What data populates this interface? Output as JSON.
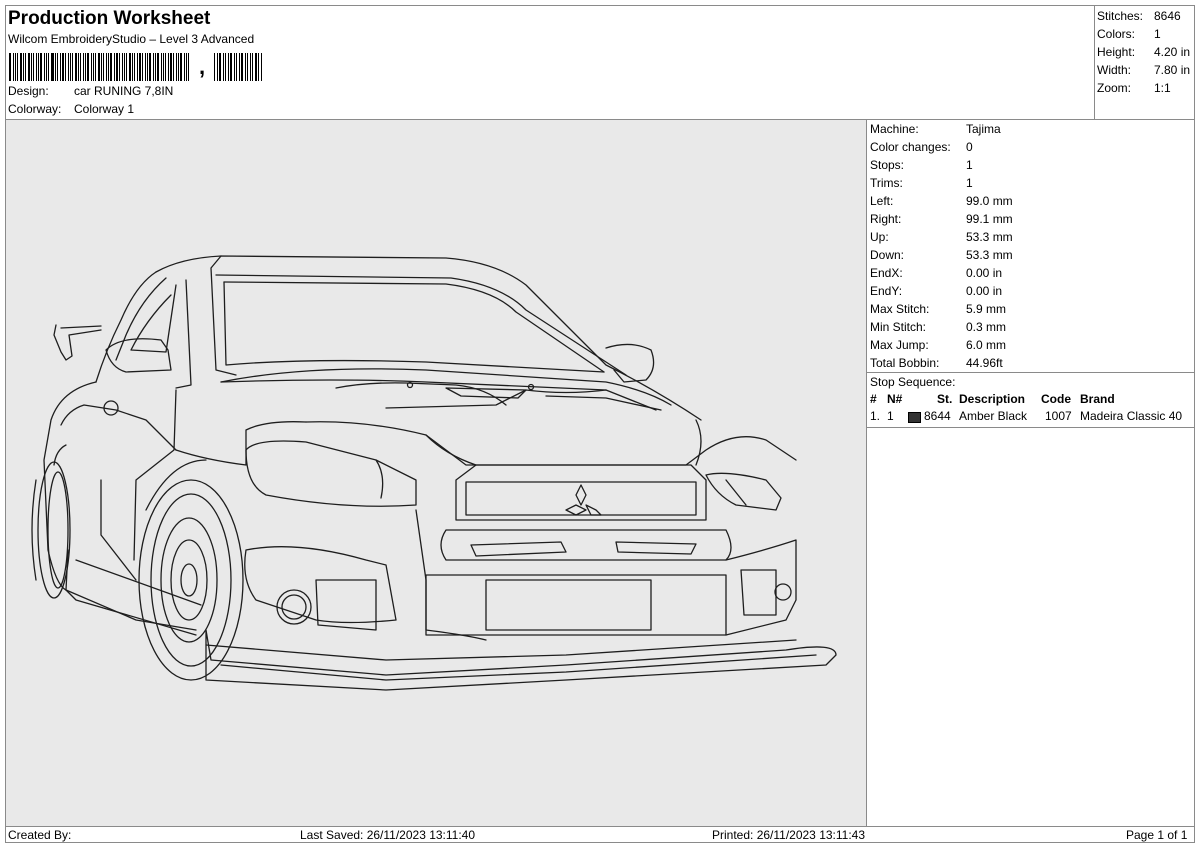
{
  "header": {
    "title": "Production Worksheet",
    "subtitle": "Wilcom EmbroideryStudio – Level 3 Advanced",
    "barcode_suffix": ",",
    "design_label": "Design:",
    "design_value": "car RUNING 7,8IN",
    "colorway_label": "Colorway:",
    "colorway_value": "Colorway 1"
  },
  "stats": [
    {
      "label": "Stitches:",
      "value": "8646"
    },
    {
      "label": "Colors:",
      "value": "1"
    },
    {
      "label": "Height:",
      "value": "4.20 in"
    },
    {
      "label": "Width:",
      "value": "7.80 in"
    },
    {
      "label": "Zoom:",
      "value": "1:1"
    }
  ],
  "details": [
    {
      "label": "Machine:",
      "value": "Tajima"
    },
    {
      "label": "Color changes:",
      "value": "0"
    },
    {
      "label": "Stops:",
      "value": "1"
    },
    {
      "label": "Trims:",
      "value": "1"
    },
    {
      "label": "Left:",
      "value": "99.0 mm"
    },
    {
      "label": "Right:",
      "value": "99.1 mm"
    },
    {
      "label": "Up:",
      "value": "53.3 mm"
    },
    {
      "label": "Down:",
      "value": "53.3 mm"
    },
    {
      "label": "EndX:",
      "value": "0.00 in"
    },
    {
      "label": "EndY:",
      "value": "0.00 in"
    },
    {
      "label": "Max Stitch:",
      "value": "5.9 mm"
    },
    {
      "label": "Min Stitch:",
      "value": "0.3 mm"
    },
    {
      "label": "Max Jump:",
      "value": "6.0 mm"
    },
    {
      "label": "Total Bobbin:",
      "value": "44.96ft"
    }
  ],
  "stop_sequence": {
    "title": "Stop Sequence:",
    "headers": {
      "num": "#",
      "n": "N#",
      "st": "St.",
      "description": "Description",
      "code": "Code",
      "brand": "Brand"
    },
    "rows": [
      {
        "num": "1.",
        "n": "1",
        "swatch_color": "#333333",
        "st": "8644",
        "description": "Amber Black",
        "code": "1007",
        "brand": "Madeira Classic 40"
      }
    ]
  },
  "footer": {
    "created_by": "Created By:",
    "last_saved": "Last Saved: 26/11/2023 13:11:40",
    "printed": "Printed: 26/11/2023 13:11:43",
    "page": "Page 1 of 1"
  },
  "colors": {
    "design_background": "#e9e9e9",
    "thread": "#1e1e1e",
    "border": "#8a8a8a"
  }
}
